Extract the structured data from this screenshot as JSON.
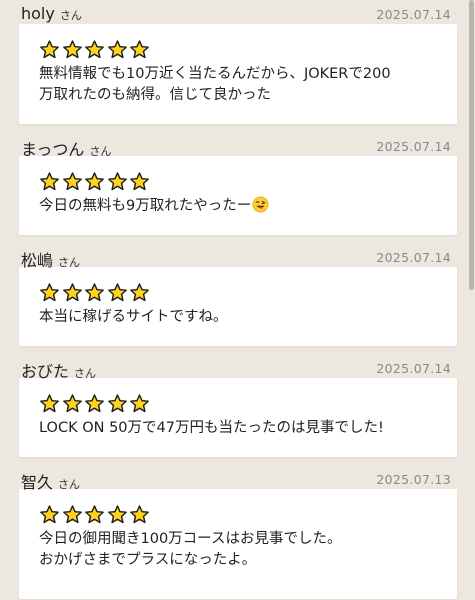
{
  "colors": {
    "background": "#ece7df",
    "card": "#ffffff",
    "star_fill": "#ffd21e",
    "star_stroke": "#1a1a1a",
    "date_text": "#8a8a8a"
  },
  "honorific": "さん",
  "reviews": [
    {
      "name": "holy",
      "date": "2025.07.14",
      "rating": 5,
      "comment": "無料情報でも10万近く当たるんだから、JOKERで200\n万取れたのも納得。信じて良かった",
      "emoji": ""
    },
    {
      "name": "まっつん",
      "date": "2025.07.14",
      "rating": 5,
      "comment": "今日の無料も9万取れたやったー",
      "emoji": "grinning-tongue-wink-emoji"
    },
    {
      "name": "松嶋",
      "date": "2025.07.14",
      "rating": 5,
      "comment": "本当に稼げるサイトですね。",
      "emoji": ""
    },
    {
      "name": "おびた",
      "date": "2025.07.14",
      "rating": 5,
      "comment": "LOCK ON 50万で47万円も当たったのは見事でした!",
      "emoji": ""
    },
    {
      "name": "智久",
      "date": "2025.07.13",
      "rating": 5,
      "comment": "今日の御用聞き100万コースはお見事でした。\nおかげさまでプラスになったよ。",
      "emoji": ""
    }
  ]
}
